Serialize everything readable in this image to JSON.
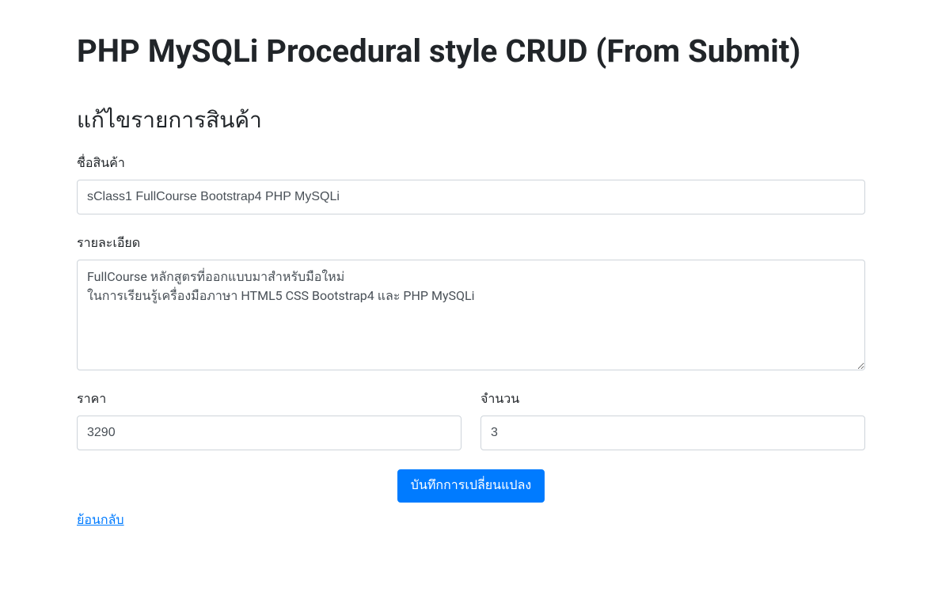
{
  "page": {
    "title": "PHP MySQLi Procedural style CRUD (From Submit)",
    "subheading": "แก้ไขรายการสินค้า"
  },
  "form": {
    "productName": {
      "label": "ชื่อสินค้า",
      "value": "sClass1 FullCourse Bootstrap4 PHP MySQLi"
    },
    "details": {
      "label": "รายละเอียด",
      "value": "FullCourse หลักสูตรที่ออกแบบมาสำหรับมือใหม่\nในการเรียนรู้เครื่องมือภาษา HTML5 CSS Bootstrap4 และ PHP MySQLi"
    },
    "price": {
      "label": "ราคา",
      "value": "3290"
    },
    "quantity": {
      "label": "จำนวน",
      "value": "3"
    },
    "submitLabel": "บันทึกการเปลี่ยนแปลง",
    "backLabel": "ย้อนกลับ"
  }
}
